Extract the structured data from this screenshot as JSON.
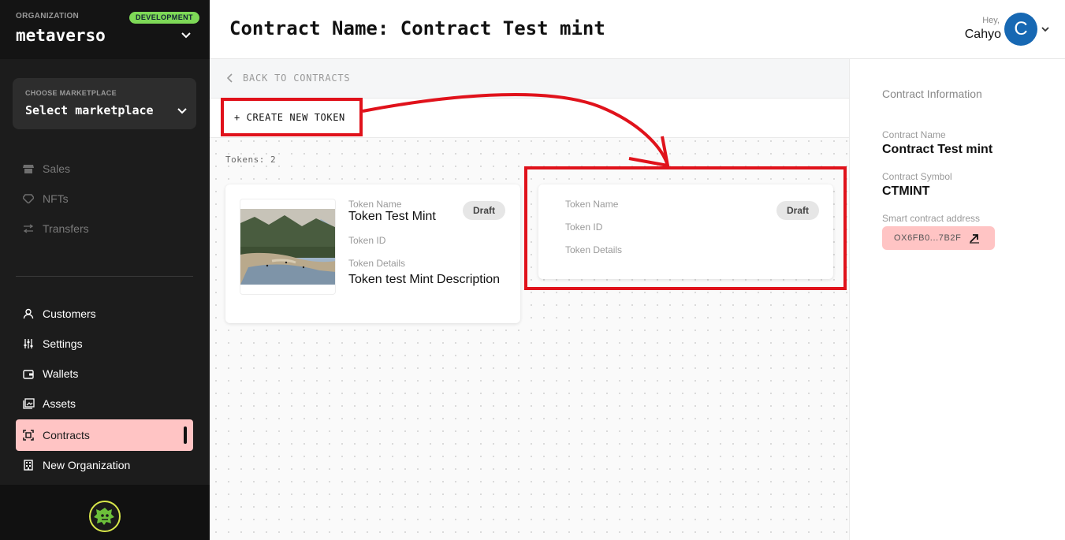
{
  "colors": {
    "accent": "#ffc4c4",
    "badge": "#7ed957",
    "avatar": "#1768b3",
    "annotation": "#e0121b"
  },
  "org": {
    "label": "ORGANIZATION",
    "badge": "DEVELOPMENT",
    "name": "metaverso"
  },
  "marketplace": {
    "label": "CHOOSE MARKETPLACE",
    "value": "Select marketplace"
  },
  "nav_top": [
    {
      "label": "Sales",
      "icon": "store-icon"
    },
    {
      "label": "NFTs",
      "icon": "diamond-icon"
    },
    {
      "label": "Transfers",
      "icon": "transfer-icon"
    }
  ],
  "nav_bottom": [
    {
      "label": "Customers",
      "icon": "user-icon"
    },
    {
      "label": "Settings",
      "icon": "sliders-icon"
    },
    {
      "label": "Wallets",
      "icon": "wallet-icon"
    },
    {
      "label": "Assets",
      "icon": "image-icon"
    },
    {
      "label": "Contracts",
      "icon": "contract-icon",
      "active": true
    },
    {
      "label": "New Organization",
      "icon": "building-icon"
    }
  ],
  "header": {
    "title": "Contract Name: Contract Test mint",
    "greeting": "Hey,",
    "user": "Cahyo",
    "avatar_initial": "C"
  },
  "main": {
    "back_label": "BACK TO CONTRACTS",
    "create_label": "+ CREATE NEW TOKEN",
    "tokens_count": "Tokens: 2"
  },
  "tokens": [
    {
      "name_label": "Token Name",
      "name": "Token Test Mint",
      "id_label": "Token ID",
      "details_label": "Token Details",
      "details": "Token test Mint Description",
      "status": "Draft"
    },
    {
      "name_label": "Token Name",
      "id_label": "Token ID",
      "details_label": "Token Details",
      "status": "Draft"
    }
  ],
  "info": {
    "title": "Contract Information",
    "name_label": "Contract Name",
    "name": "Contract Test mint",
    "symbol_label": "Contract Symbol",
    "symbol": "CTMINT",
    "address_label": "Smart contract address",
    "address": "OX6FB0...7B2F"
  }
}
